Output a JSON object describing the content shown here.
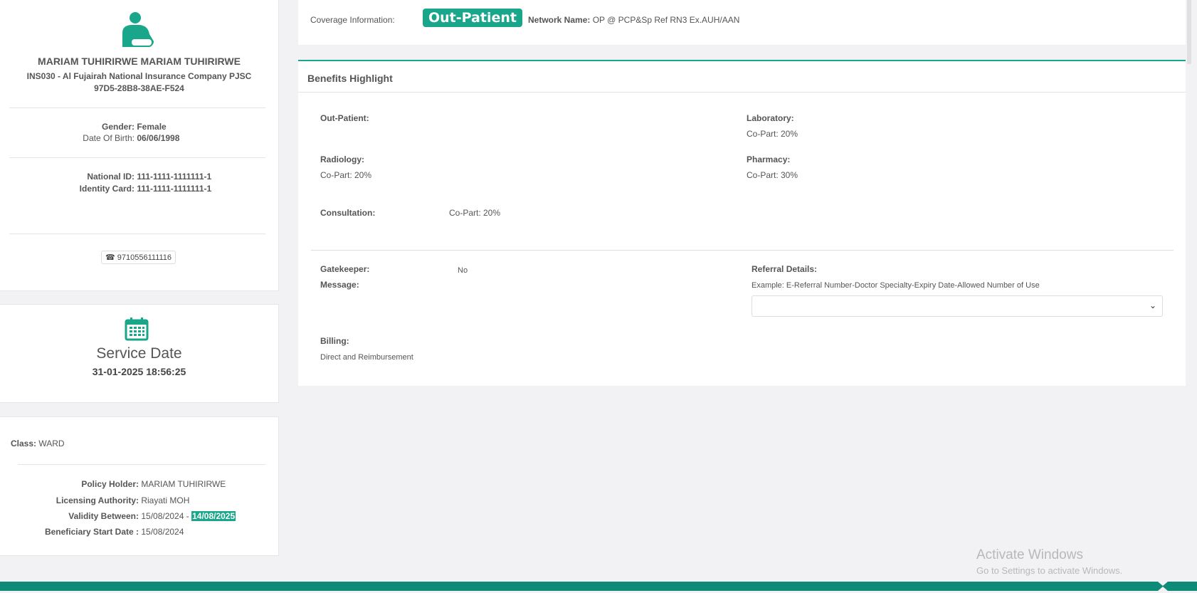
{
  "member": {
    "name": "MARIAM TUHIRIRWE MARIAM TUHIRIRWE",
    "insurer": "INS030 - Al Fujairah National Insurance Company PJSC",
    "member_id": "97D5-28B8-38AE-F524",
    "gender_label": "Gender:",
    "gender": "Female",
    "dob_label": "Date Of Birth:",
    "dob": "06/06/1998",
    "national_id_label": "National ID:",
    "national_id": "111-1111-1111111-1",
    "identity_card_label": "Identity Card:",
    "identity_card": "111-1111-1111111-1",
    "phone": "9710556111116"
  },
  "service": {
    "title": "Service Date",
    "datetime": "31-01-2025 18:56:25"
  },
  "policy": {
    "class_label": "Class:",
    "class": "WARD",
    "holder_label": "Policy Holder:",
    "holder": "MARIAM TUHIRIRWE",
    "authority_label": "Licensing Authority:",
    "authority": "Riayati MOH",
    "validity_label": "Validity Between:",
    "validity_from": "15/08/2024",
    "validity_sep": "-",
    "validity_to": "14/08/2025",
    "start_label": "Beneficiary Start Date :",
    "start": "15/08/2024"
  },
  "coverage": {
    "label": "Coverage Information:",
    "type": "Out-Patient",
    "network_label": "Network Name:",
    "network": "OP @ PCP&Sp Ref RN3 Ex.AUH/AAN"
  },
  "benefits": {
    "title": "Benefits Highlight",
    "outpatient": "Out-Patient:",
    "laboratory": "Laboratory:",
    "laboratory_val": "Co-Part: 20%",
    "radiology": "Radiology:",
    "radiology_val": "Co-Part: 20%",
    "pharmacy": "Pharmacy:",
    "pharmacy_val": "Co-Part: 30%",
    "consultation": "Consultation:",
    "consultation_val": "Co-Part: 20%",
    "gatekeeper": "Gatekeeper:",
    "gatekeeper_val": "No",
    "message": "Message:",
    "referral": "Referral Details:",
    "referral_example": "Example: E-Referral Number-Doctor Specialty-Expiry Date-Allowed Number of Use",
    "billing": "Billing:",
    "billing_val": "Direct and Reimbursement"
  },
  "watermark": {
    "title": "Activate Windows",
    "sub": "Go to Settings to activate Windows."
  },
  "colors": {
    "accent": "#1aa68a",
    "footer": "#0e8a78"
  }
}
